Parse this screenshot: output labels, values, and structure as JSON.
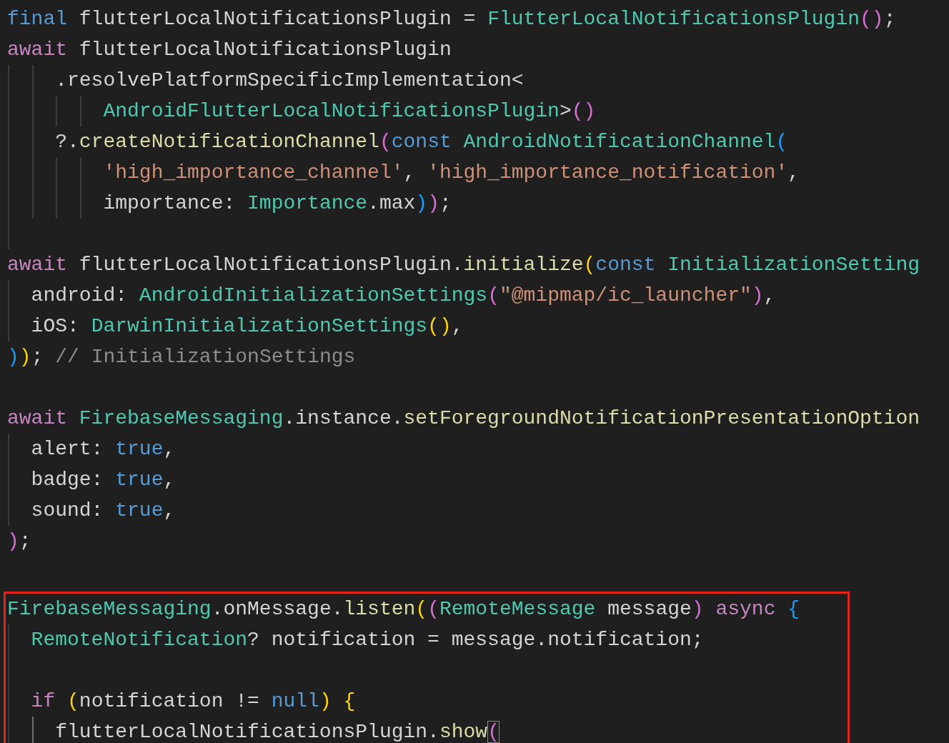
{
  "blocks": [
    {
      "highlighted": false,
      "lines": [
        {
          "tokens": [
            {
              "text": "final",
              "kind": "keyword"
            },
            {
              "text": " flutterLocalNotificationsPlugin = ",
              "kind": "plain"
            },
            {
              "text": "FlutterLocalNotificationsPlugin",
              "kind": "type"
            },
            {
              "text": "()",
              "kind": "bracket2"
            },
            {
              "text": ";",
              "kind": "plain"
            }
          ]
        },
        {
          "tokens": [
            {
              "text": "await",
              "kind": "control"
            },
            {
              "text": " flutterLocalNotificationsPlugin",
              "kind": "plain"
            }
          ]
        },
        {
          "guides": [
            {
              "active": false
            },
            {
              "active": false
            }
          ],
          "tokens": [
            {
              "text": "    .resolvePlatformSpecificImplementation<",
              "kind": "plain"
            }
          ]
        },
        {
          "guides": [
            {
              "active": false
            },
            {
              "active": false
            },
            {
              "active": false
            },
            {
              "active": false
            }
          ],
          "tokens": [
            {
              "text": "        AndroidFlutterLocalNotificationsPlugin",
              "kind": "type"
            },
            {
              "text": ">",
              "kind": "plain"
            },
            {
              "text": "()",
              "kind": "bracket2"
            }
          ]
        },
        {
          "guides": [
            {
              "active": false
            },
            {
              "active": false
            }
          ],
          "tokens": [
            {
              "text": "    ?.",
              "kind": "plain"
            },
            {
              "text": "createNotificationChannel",
              "kind": "function"
            },
            {
              "text": "(",
              "kind": "bracket2"
            },
            {
              "text": "const",
              "kind": "keyword"
            },
            {
              "text": " AndroidNotificationChannel",
              "kind": "type"
            },
            {
              "text": "(",
              "kind": "bracket3"
            }
          ]
        },
        {
          "guides": [
            {
              "active": false
            },
            {
              "active": false
            },
            {
              "active": false
            },
            {
              "active": false
            }
          ],
          "tokens": [
            {
              "text": "        'high_importance_channel'",
              "kind": "string"
            },
            {
              "text": ", ",
              "kind": "plain"
            },
            {
              "text": "'high_importance_notification'",
              "kind": "string"
            },
            {
              "text": ",",
              "kind": "plain"
            }
          ]
        },
        {
          "guides": [
            {
              "active": false
            },
            {
              "active": false
            },
            {
              "active": false
            },
            {
              "active": false
            }
          ],
          "tokens": [
            {
              "text": "        importance: ",
              "kind": "plain"
            },
            {
              "text": "Importance",
              "kind": "type"
            },
            {
              "text": ".max",
              "kind": "plain"
            },
            {
              "text": ")",
              "kind": "bracket3"
            },
            {
              "text": ")",
              "kind": "bracket2"
            },
            {
              "text": ";",
              "kind": "plain"
            }
          ]
        },
        {
          "guides": [
            {
              "active": false
            }
          ]
        },
        {
          "tokens": [
            {
              "text": "await",
              "kind": "control"
            },
            {
              "text": " flutterLocalNotificationsPlugin.",
              "kind": "plain"
            },
            {
              "text": "initialize",
              "kind": "function"
            },
            {
              "text": "(",
              "kind": "bracket1"
            },
            {
              "text": "const",
              "kind": "keyword"
            },
            {
              "text": " InitializationSetting",
              "kind": "type"
            }
          ]
        },
        {
          "guides": [
            {
              "active": false
            }
          ],
          "tokens": [
            {
              "text": "  android: ",
              "kind": "plain"
            },
            {
              "text": "AndroidInitializationSettings",
              "kind": "type"
            },
            {
              "text": "(",
              "kind": "bracket2"
            },
            {
              "text": "\"@mipmap/ic_launcher\"",
              "kind": "string"
            },
            {
              "text": ")",
              "kind": "bracket2"
            },
            {
              "text": ",",
              "kind": "plain"
            }
          ]
        },
        {
          "guides": [
            {
              "active": false
            }
          ],
          "tokens": [
            {
              "text": "  iOS: ",
              "kind": "plain"
            },
            {
              "text": "DarwinInitializationSettings",
              "kind": "type"
            },
            {
              "text": "()",
              "kind": "bracket1"
            },
            {
              "text": ",",
              "kind": "plain"
            }
          ]
        },
        {
          "tokens": [
            {
              "text": ")",
              "kind": "bracket3"
            },
            {
              "text": ")",
              "kind": "bracket1"
            },
            {
              "text": "; ",
              "kind": "plain"
            },
            {
              "text": "// InitializationSettings",
              "kind": "hint"
            }
          ]
        }
      ]
    },
    {
      "highlighted": false,
      "lines": [
        {
          "tokens": [
            {
              "text": "await",
              "kind": "control"
            },
            {
              "text": " FirebaseMessaging",
              "kind": "type"
            },
            {
              "text": ".instance.",
              "kind": "plain"
            },
            {
              "text": "setForegroundNotificationPresentationOption",
              "kind": "function"
            }
          ]
        },
        {
          "guides": [
            {
              "active": false
            }
          ],
          "tokens": [
            {
              "text": "  alert: ",
              "kind": "plain"
            },
            {
              "text": "true",
              "kind": "keyword"
            },
            {
              "text": ",",
              "kind": "plain"
            }
          ]
        },
        {
          "guides": [
            {
              "active": false
            }
          ],
          "tokens": [
            {
              "text": "  badge: ",
              "kind": "plain"
            },
            {
              "text": "true",
              "kind": "keyword"
            },
            {
              "text": ",",
              "kind": "plain"
            }
          ]
        },
        {
          "guides": [
            {
              "active": false
            }
          ],
          "tokens": [
            {
              "text": "  sound: ",
              "kind": "plain"
            },
            {
              "text": "true",
              "kind": "keyword"
            },
            {
              "text": ",",
              "kind": "plain"
            }
          ]
        },
        {
          "tokens": [
            {
              "text": ")",
              "kind": "bracket2"
            },
            {
              "text": ";",
              "kind": "plain"
            }
          ]
        }
      ]
    },
    {
      "highlighted": true,
      "lines": [
        {
          "tokens": [
            {
              "text": "FirebaseMessaging",
              "kind": "type"
            },
            {
              "text": ".onMessage.",
              "kind": "plain"
            },
            {
              "text": "listen",
              "kind": "function"
            },
            {
              "text": "(",
              "kind": "bracket1"
            },
            {
              "text": "(",
              "kind": "bracket2"
            },
            {
              "text": "RemoteMessage",
              "kind": "type"
            },
            {
              "text": " message",
              "kind": "plain"
            },
            {
              "text": ")",
              "kind": "bracket2"
            },
            {
              "text": " async",
              "kind": "control"
            },
            {
              "text": " {",
              "kind": "bracket3"
            }
          ]
        },
        {
          "guides": [
            {
              "active": false
            }
          ],
          "tokens": [
            {
              "text": "  RemoteNotification",
              "kind": "type"
            },
            {
              "text": "? notification = message.notification;",
              "kind": "plain"
            }
          ]
        },
        {
          "guides": [
            {
              "active": false
            }
          ]
        },
        {
          "guides": [
            {
              "active": false
            }
          ],
          "tokens": [
            {
              "text": "  if",
              "kind": "control"
            },
            {
              "text": " (",
              "kind": "bracket1"
            },
            {
              "text": "notification != ",
              "kind": "plain"
            },
            {
              "text": "null",
              "kind": "keyword"
            },
            {
              "text": ")",
              "kind": "bracket1"
            },
            {
              "text": " {",
              "kind": "bracket1"
            }
          ]
        },
        {
          "guides": [
            {
              "active": false
            },
            {
              "active": true
            }
          ],
          "tokens": [
            {
              "text": "    flutterLocalNotificationsPlugin.",
              "kind": "plain"
            },
            {
              "text": "show",
              "kind": "function"
            },
            {
              "text": "(",
              "kind": "bracket2",
              "boxed": true
            }
          ]
        }
      ]
    }
  ]
}
